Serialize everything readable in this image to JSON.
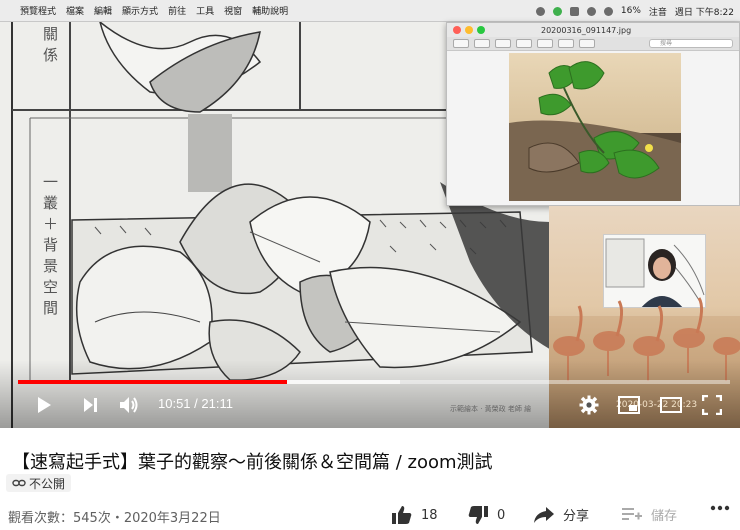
{
  "menubar": {
    "items": [
      "預覽程式",
      "檔案",
      "編輯",
      "顯示方式",
      "前往",
      "工具",
      "視窗",
      "輔助說明"
    ],
    "battery": "16%",
    "input_method": "注音",
    "clock": "週日 下午8:22"
  },
  "preview": {
    "filename": "20200316_091147.jpg",
    "search_placeholder": "搜尋"
  },
  "paper": {
    "label_top": "關係",
    "label_side": "一叢＋背景空間"
  },
  "player": {
    "current_time": "10:51",
    "duration": "21:11",
    "time_display": "10:51 / 21:11",
    "progress": 0.51,
    "watermark": "示範繪本 · 黃榮政 老師 繪",
    "cam_timestamp": "2020-03-22 20:23"
  },
  "video": {
    "title": "【速寫起手式】葉子的觀察～前後關係＆空間篇 / zoom測試",
    "visibility": "不公開",
    "meta": "觀看次數：545次・2020年3月22日"
  },
  "actions": {
    "like_count": "18",
    "dislike_count": "0",
    "share_label": "分享",
    "save_label": "儲存"
  },
  "colors": {
    "progress": "#ff0000",
    "title": "#0f0f0f",
    "meta": "#606060"
  }
}
